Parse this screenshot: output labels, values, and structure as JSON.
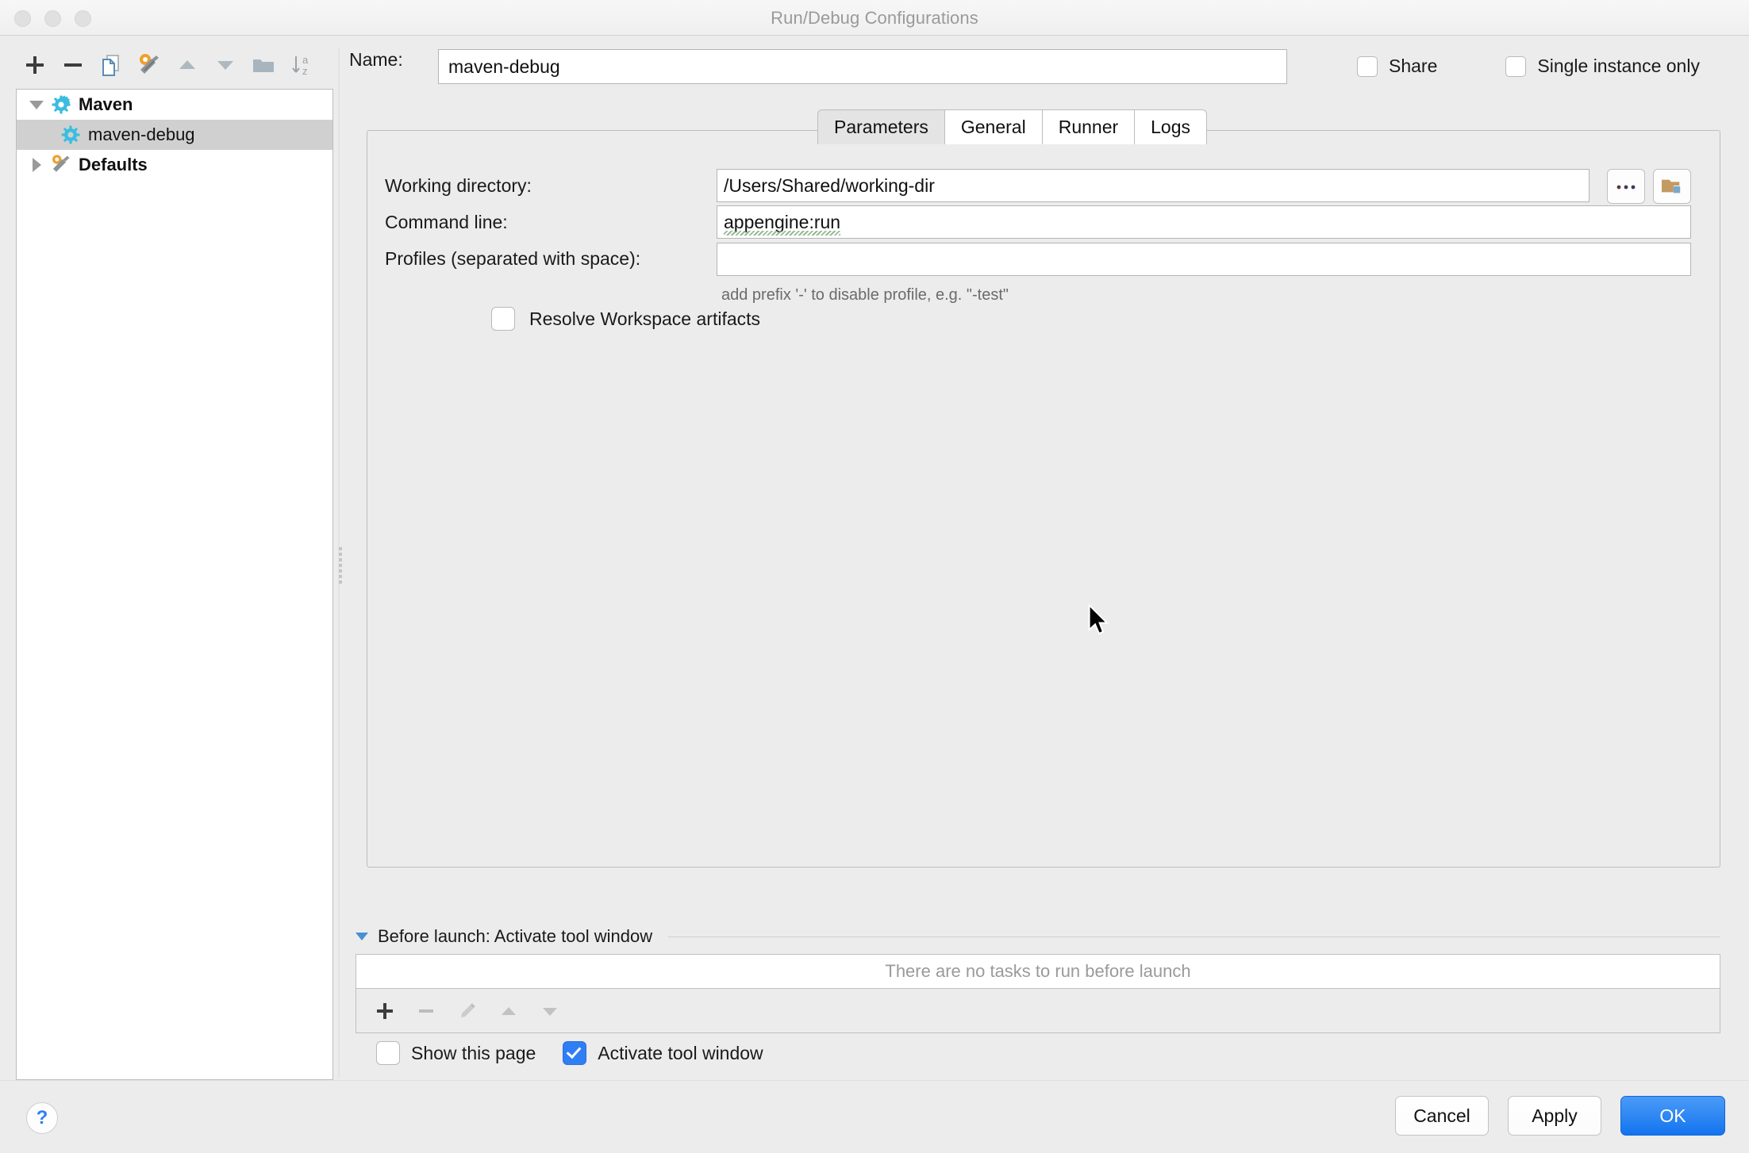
{
  "window": {
    "title": "Run/Debug Configurations",
    "traffic_lights": [
      "close-button",
      "minimize-button",
      "zoom-button"
    ]
  },
  "toolbar": {
    "buttons": [
      {
        "name": "add-configuration-button",
        "icon": "plus-icon",
        "label": "+"
      },
      {
        "name": "remove-configuration-button",
        "icon": "minus-icon",
        "label": "−"
      },
      {
        "name": "copy-configuration-button",
        "icon": "copy-icon",
        "label": "Copy"
      },
      {
        "name": "edit-defaults-button",
        "icon": "wrench-icon",
        "label": "Edit defaults"
      },
      {
        "name": "move-up-button",
        "icon": "arrow-up-icon",
        "label": "Move Up"
      },
      {
        "name": "move-down-button",
        "icon": "arrow-down-icon",
        "label": "Move Down"
      },
      {
        "name": "create-folder-button",
        "icon": "folder-icon",
        "label": "Create New Folder"
      },
      {
        "name": "sort-configurations-button",
        "icon": "sort-az-icon",
        "label": "Sort Configurations"
      }
    ]
  },
  "tree": {
    "items": [
      {
        "label": "Maven",
        "icon": "maven-gear-icon",
        "expanded": true,
        "bold": true,
        "selected": false,
        "indent": 0
      },
      {
        "label": "maven-debug",
        "icon": "maven-gear-icon",
        "expanded": null,
        "bold": false,
        "selected": true,
        "indent": 1
      },
      {
        "label": "Defaults",
        "icon": "wrench-icon",
        "expanded": false,
        "bold": true,
        "selected": false,
        "indent": 0
      }
    ]
  },
  "name_row": {
    "label": "Name:",
    "value": "maven-debug",
    "placeholder": "",
    "share": {
      "label": "Share",
      "checked": false
    },
    "single_instance": {
      "label": "Single instance only",
      "checked": false
    }
  },
  "tabs": {
    "items": [
      {
        "label": "Parameters",
        "active": true
      },
      {
        "label": "General",
        "active": false
      },
      {
        "label": "Runner",
        "active": false
      },
      {
        "label": "Logs",
        "active": false
      }
    ]
  },
  "parameters": {
    "working_directory": {
      "label": "Working directory:",
      "value": "/Users/Shared/working-dir",
      "browse_button": "...",
      "folder_button": "folder-icon"
    },
    "command_line": {
      "label": "Command line:",
      "value": "appengine:run"
    },
    "profiles": {
      "label": "Profiles (separated with space):",
      "value": "",
      "hint": "add prefix '-' to disable profile, e.g. \"-test\""
    },
    "resolve_workspace_artifacts": {
      "label": "Resolve Workspace artifacts",
      "checked": false
    }
  },
  "before_launch": {
    "title": "Before launch: Activate tool window",
    "expanded": true,
    "empty_message": "There are no tasks to run before launch",
    "toolbar": [
      {
        "name": "add-task-button",
        "icon": "plus-icon",
        "enabled": true
      },
      {
        "name": "remove-task-button",
        "icon": "minus-icon",
        "enabled": false
      },
      {
        "name": "edit-task-button",
        "icon": "pencil-icon",
        "enabled": false
      },
      {
        "name": "move-task-up-button",
        "icon": "arrow-up-icon",
        "enabled": false
      },
      {
        "name": "move-task-down-button",
        "icon": "arrow-down-icon",
        "enabled": false
      }
    ],
    "show_this_page": {
      "label": "Show this page",
      "checked": false
    },
    "activate_tool_window": {
      "label": "Activate tool window",
      "checked": true
    }
  },
  "footer": {
    "help": "?",
    "cancel": "Cancel",
    "apply": "Apply",
    "ok": "OK"
  },
  "colors": {
    "accent": "#2f7ef5",
    "window_bg": "#ececec",
    "panel_border": "#bdbdbd",
    "selection": "#d0d0d0",
    "hint_text": "#6b6b6b",
    "title_text": "#9a9a9a"
  }
}
